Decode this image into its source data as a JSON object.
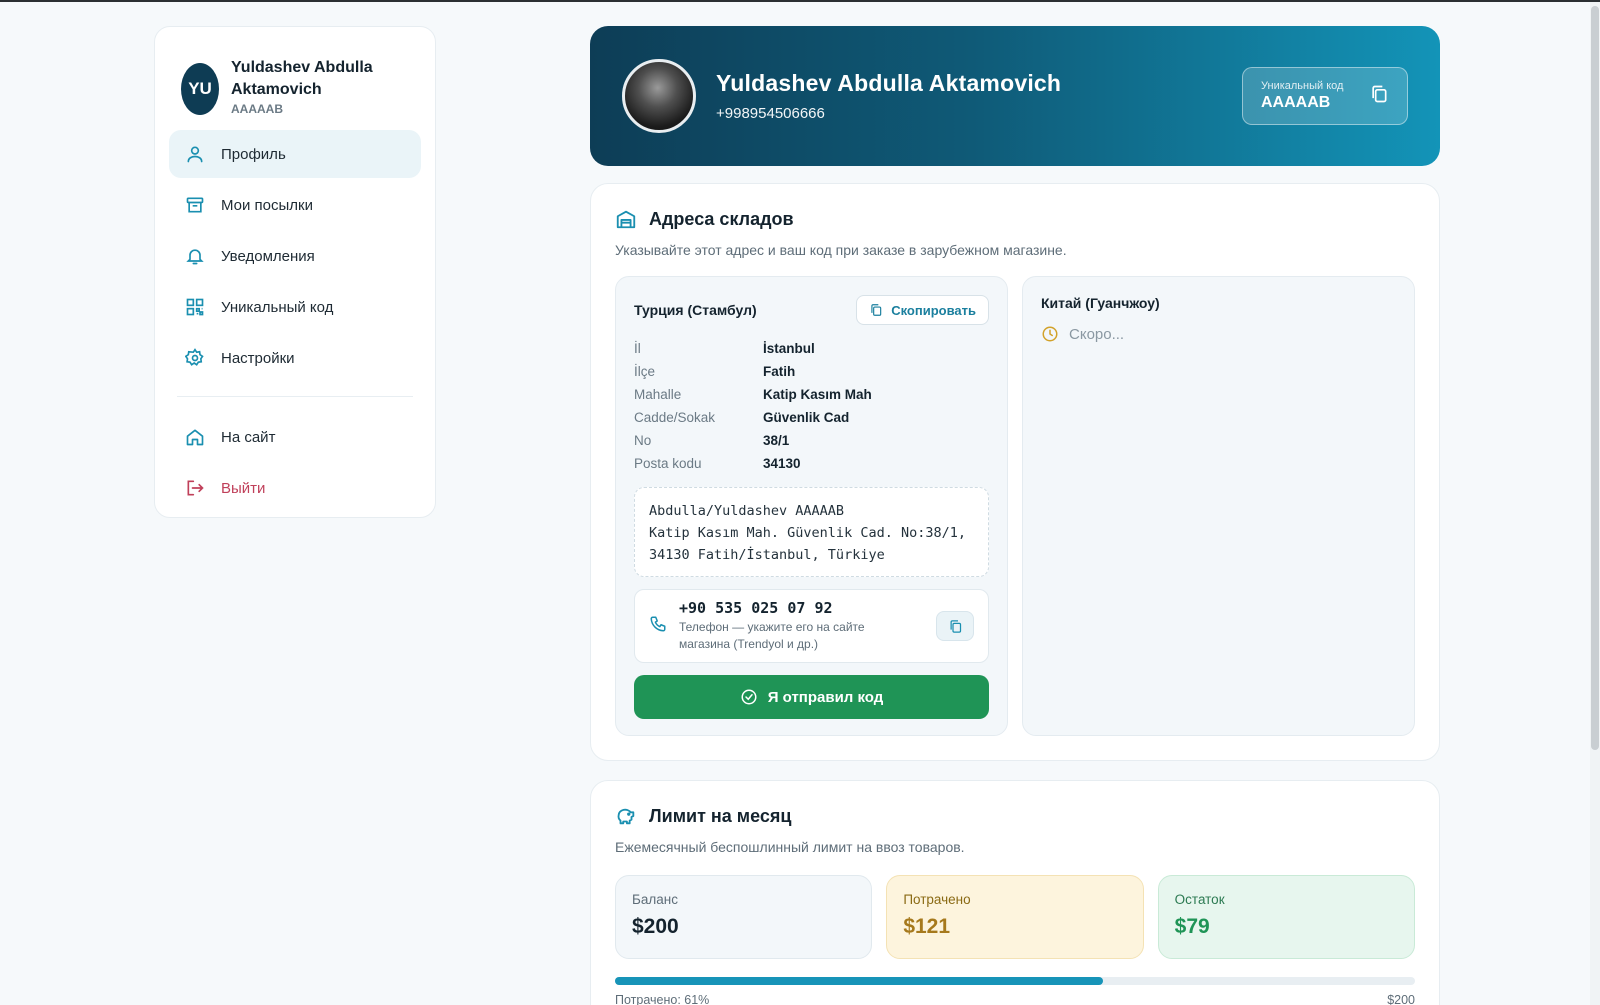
{
  "user": {
    "initials": "YU",
    "name": "Yuldashev Abdulla Aktamovich",
    "code": "AAAAAB",
    "phone": "+998954506666"
  },
  "banner": {
    "code_label": "Уникальный код",
    "code_value": "AAAAAB"
  },
  "sidebar": {
    "items": [
      {
        "label": "Профиль",
        "icon": "user-icon"
      },
      {
        "label": "Мои посылки",
        "icon": "box-icon"
      },
      {
        "label": "Уведомления",
        "icon": "bell-icon"
      },
      {
        "label": "Уникальный код",
        "icon": "qr-icon"
      },
      {
        "label": "Настройки",
        "icon": "gear-icon"
      }
    ],
    "site_label": "На сайт",
    "logout_label": "Выйти"
  },
  "warehouses": {
    "title": "Адреса складов",
    "subtitle": "Указывайте этот адрес и ваш код при заказе в зарубежном магазине.",
    "turkey": {
      "name": "Турция (Стамбул)",
      "copy_label": "Скопировать",
      "rows": [
        {
          "key": "İl",
          "value": "İstanbul"
        },
        {
          "key": "İlçe",
          "value": "Fatih"
        },
        {
          "key": "Mahalle",
          "value": "Katip Kasım Mah"
        },
        {
          "key": "Cadde/Sokak",
          "value": "Güvenlik Cad"
        },
        {
          "key": "No",
          "value": "38/1"
        },
        {
          "key": "Posta kodu",
          "value": "34130"
        }
      ],
      "full_address": [
        "Abdulla/Yuldashev AAAAAB",
        "Katip Kasım Mah. Güvenlik Cad. No:38/1,",
        "34130 Fatih/İstanbul, Türkiye"
      ],
      "phone": "+90 535 025 07 92",
      "phone_hint": "Телефон — укажите его на сайте магазина (Trendyol и др.)",
      "sent_label": "Я отправил код"
    },
    "china": {
      "name": "Китай (Гуанчжоу)",
      "soon": "Скоро..."
    }
  },
  "limit": {
    "title": "Лимит на месяц",
    "subtitle": "Ежемесячный беспошлинный лимит на ввоз товаров.",
    "balance_label": "Баланс",
    "balance_value": "$200",
    "spent_label": "Потрачено",
    "spent_value": "$121",
    "rest_label": "Остаток",
    "rest_value": "$79",
    "progress_percent": 61,
    "progress_text": "Потрачено: 61%",
    "progress_max": "$200"
  },
  "colors": {
    "accent": "#1794b8",
    "success": "#1f9456",
    "danger": "#c0405a"
  }
}
